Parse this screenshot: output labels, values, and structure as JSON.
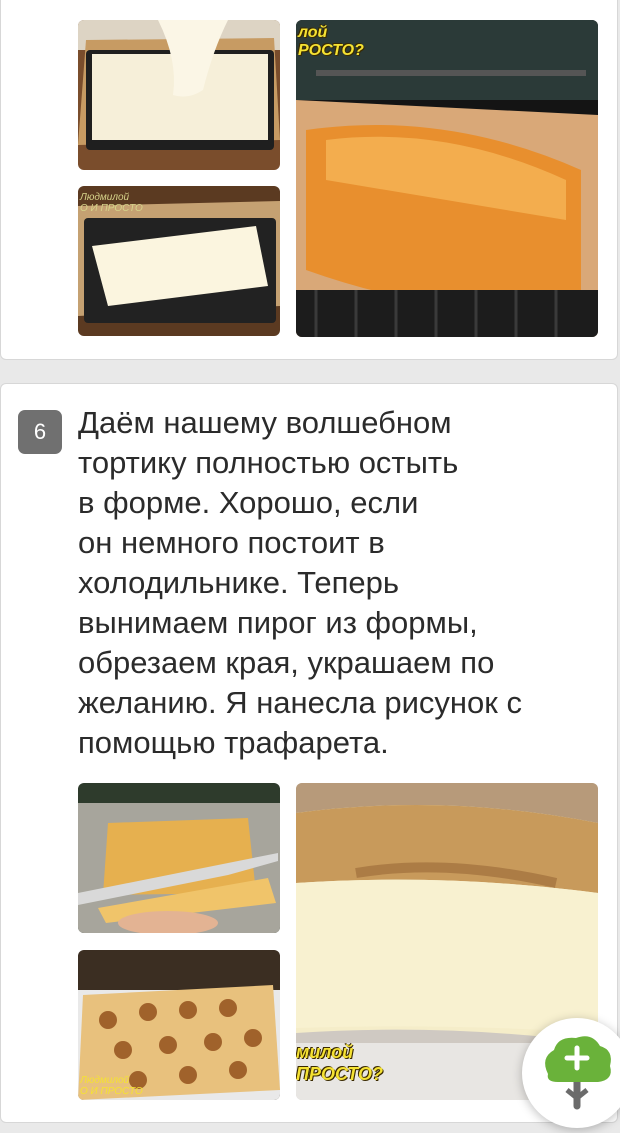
{
  "step": {
    "number": "6",
    "text": "Даём нашему волшебном\nтортику полностью остыть\nв форме. Хорошо, если\nон немного постоит в\nхолодильнике. Теперь\nвынимаем пирог из формы,\nобрезаем края, украшаем по\nжеланию. Я нанесла рисунок  с\nпомощью трафарета."
  },
  "watermarks": {
    "oven_top": "лой\nРОСТО?",
    "bottom_big": "милой\nПРОСТО?",
    "bottom_small": "Людмилой\nО И ПРОСТО"
  },
  "icons": {
    "fab": "add-tree-icon"
  },
  "colors": {
    "badge": "#707070",
    "fab_green": "#6ab23a"
  }
}
